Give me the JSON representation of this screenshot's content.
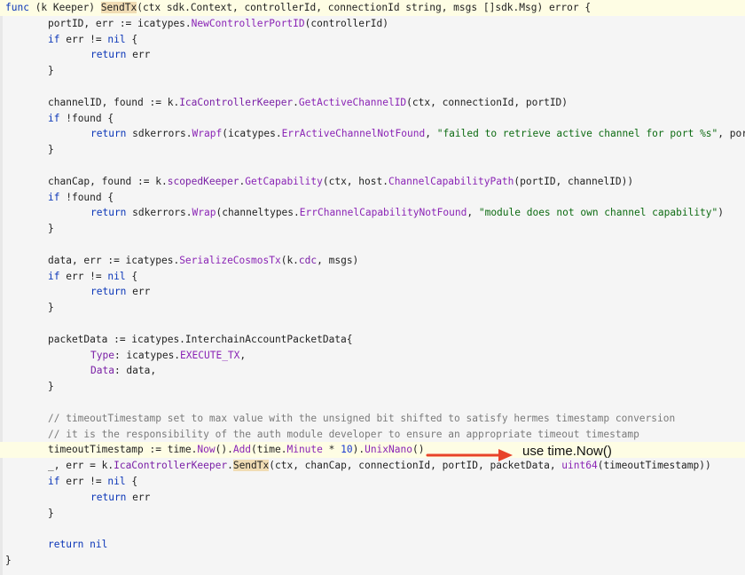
{
  "code_lines": [
    {
      "top": 0,
      "highlight": true,
      "tokens": [
        {
          "t": "func",
          "c": "kw"
        },
        {
          "t": " (k Keeper) ",
          "c": ""
        },
        {
          "t": "SendTx",
          "c": "sendtx"
        },
        {
          "t": "(ctx sdk.Context, controllerId, connectionId string, msgs []sdk.Msg) error {",
          "c": ""
        }
      ]
    },
    {
      "indent": 1,
      "tokens": [
        {
          "t": "portID, err := icatypes.",
          "c": ""
        },
        {
          "t": "NewControllerPortID",
          "c": "fn"
        },
        {
          "t": "(controllerId)",
          "c": ""
        }
      ]
    },
    {
      "indent": 1,
      "tokens": [
        {
          "t": "if",
          "c": "kw"
        },
        {
          "t": " err != ",
          "c": ""
        },
        {
          "t": "nil",
          "c": "kw"
        },
        {
          "t": " {",
          "c": ""
        }
      ]
    },
    {
      "indent": 2,
      "tokens": [
        {
          "t": "return",
          "c": "kw"
        },
        {
          "t": " err",
          "c": ""
        }
      ]
    },
    {
      "indent": 1,
      "tokens": [
        {
          "t": "}",
          "c": ""
        }
      ]
    },
    {
      "indent": 0,
      "tokens": []
    },
    {
      "indent": 1,
      "tokens": [
        {
          "t": "channelID, found := k.",
          "c": ""
        },
        {
          "t": "IcaControllerKeeper",
          "c": "fld"
        },
        {
          "t": ".",
          "c": ""
        },
        {
          "t": "GetActiveChannelID",
          "c": "fn"
        },
        {
          "t": "(ctx, connectionId, portID)",
          "c": ""
        }
      ]
    },
    {
      "indent": 1,
      "tokens": [
        {
          "t": "if",
          "c": "kw"
        },
        {
          "t": " !found {",
          "c": ""
        }
      ]
    },
    {
      "indent": 2,
      "tokens": [
        {
          "t": "return",
          "c": "kw"
        },
        {
          "t": " sdkerrors.",
          "c": ""
        },
        {
          "t": "Wrapf",
          "c": "fn"
        },
        {
          "t": "(icatypes.",
          "c": ""
        },
        {
          "t": "ErrActiveChannelNotFound",
          "c": "fn"
        },
        {
          "t": ", ",
          "c": ""
        },
        {
          "t": "\"failed to retrieve active channel for port %s\"",
          "c": "str"
        },
        {
          "t": ", portID)",
          "c": ""
        }
      ]
    },
    {
      "indent": 1,
      "tokens": [
        {
          "t": "}",
          "c": ""
        }
      ]
    },
    {
      "indent": 0,
      "tokens": []
    },
    {
      "indent": 1,
      "tokens": [
        {
          "t": "chanCap, found := k.",
          "c": ""
        },
        {
          "t": "scopedKeeper",
          "c": "fld"
        },
        {
          "t": ".",
          "c": ""
        },
        {
          "t": "GetCapability",
          "c": "fn"
        },
        {
          "t": "(ctx, host.",
          "c": ""
        },
        {
          "t": "ChannelCapabilityPath",
          "c": "fn"
        },
        {
          "t": "(portID, channelID))",
          "c": ""
        }
      ]
    },
    {
      "indent": 1,
      "tokens": [
        {
          "t": "if",
          "c": "kw"
        },
        {
          "t": " !found {",
          "c": ""
        }
      ]
    },
    {
      "indent": 2,
      "tokens": [
        {
          "t": "return",
          "c": "kw"
        },
        {
          "t": " sdkerrors.",
          "c": ""
        },
        {
          "t": "Wrap",
          "c": "fn"
        },
        {
          "t": "(channeltypes.",
          "c": ""
        },
        {
          "t": "ErrChannelCapabilityNotFound",
          "c": "fn"
        },
        {
          "t": ", ",
          "c": ""
        },
        {
          "t": "\"module does not own channel capability\"",
          "c": "str"
        },
        {
          "t": ")",
          "c": ""
        }
      ]
    },
    {
      "indent": 1,
      "tokens": [
        {
          "t": "}",
          "c": ""
        }
      ]
    },
    {
      "indent": 0,
      "tokens": []
    },
    {
      "indent": 1,
      "tokens": [
        {
          "t": "data, err := icatypes.",
          "c": ""
        },
        {
          "t": "SerializeCosmosTx",
          "c": "fn"
        },
        {
          "t": "(k.",
          "c": ""
        },
        {
          "t": "cdc",
          "c": "fld"
        },
        {
          "t": ", msgs)",
          "c": ""
        }
      ]
    },
    {
      "indent": 1,
      "tokens": [
        {
          "t": "if",
          "c": "kw"
        },
        {
          "t": " err != ",
          "c": ""
        },
        {
          "t": "nil",
          "c": "kw"
        },
        {
          "t": " {",
          "c": ""
        }
      ]
    },
    {
      "indent": 2,
      "tokens": [
        {
          "t": "return",
          "c": "kw"
        },
        {
          "t": " err",
          "c": ""
        }
      ]
    },
    {
      "indent": 1,
      "tokens": [
        {
          "t": "}",
          "c": ""
        }
      ]
    },
    {
      "indent": 0,
      "tokens": []
    },
    {
      "indent": 1,
      "tokens": [
        {
          "t": "packetData := icatypes.InterchainAccountPacketData{",
          "c": ""
        }
      ]
    },
    {
      "indent": 2,
      "tokens": [
        {
          "t": "Type",
          "c": "fld"
        },
        {
          "t": ": icatypes.",
          "c": ""
        },
        {
          "t": "EXECUTE_TX",
          "c": "fn"
        },
        {
          "t": ",",
          "c": ""
        }
      ]
    },
    {
      "indent": 2,
      "tokens": [
        {
          "t": "Data",
          "c": "fld"
        },
        {
          "t": ": data,",
          "c": ""
        }
      ]
    },
    {
      "indent": 1,
      "tokens": [
        {
          "t": "}",
          "c": ""
        }
      ]
    },
    {
      "indent": 0,
      "tokens": []
    },
    {
      "indent": 1,
      "tokens": [
        {
          "t": "// timeoutTimestamp set to max value with the unsigned bit shifted to satisfy hermes timestamp conversion",
          "c": "cmt"
        }
      ]
    },
    {
      "indent": 1,
      "tokens": [
        {
          "t": "// it is the responsibility of the auth module developer to ensure an appropriate timeout timestamp",
          "c": "cmt"
        }
      ]
    },
    {
      "indent": 1,
      "highlight": true,
      "tokens": [
        {
          "t": "timeoutTimestamp := time.",
          "c": ""
        },
        {
          "t": "Now",
          "c": "fn"
        },
        {
          "t": "().",
          "c": ""
        },
        {
          "t": "Add",
          "c": "fn"
        },
        {
          "t": "(time.",
          "c": ""
        },
        {
          "t": "Minute",
          "c": "fn"
        },
        {
          "t": " * ",
          "c": ""
        },
        {
          "t": "10",
          "c": "num"
        },
        {
          "t": ").",
          "c": ""
        },
        {
          "t": "UnixNano",
          "c": "fn"
        },
        {
          "t": "()",
          "c": ""
        }
      ]
    },
    {
      "indent": 1,
      "tokens": [
        {
          "t": "_, err = k.",
          "c": ""
        },
        {
          "t": "IcaControllerKeeper",
          "c": "fld"
        },
        {
          "t": ".",
          "c": ""
        },
        {
          "t": "SendTx",
          "c": "sendtx"
        },
        {
          "t": "(ctx, chanCap, connectionId, portID, packetData, ",
          "c": ""
        },
        {
          "t": "uint64",
          "c": "fn"
        },
        {
          "t": "(timeoutTimestamp))",
          "c": ""
        }
      ]
    },
    {
      "indent": 1,
      "tokens": [
        {
          "t": "if",
          "c": "kw"
        },
        {
          "t": " err != ",
          "c": ""
        },
        {
          "t": "nil",
          "c": "kw"
        },
        {
          "t": " {",
          "c": ""
        }
      ]
    },
    {
      "indent": 2,
      "tokens": [
        {
          "t": "return",
          "c": "kw"
        },
        {
          "t": " err",
          "c": ""
        }
      ]
    },
    {
      "indent": 1,
      "tokens": [
        {
          "t": "}",
          "c": ""
        }
      ]
    },
    {
      "indent": 0,
      "tokens": []
    },
    {
      "indent": 1,
      "tokens": [
        {
          "t": "return",
          "c": "kw"
        },
        {
          "t": " ",
          "c": ""
        },
        {
          "t": "nil",
          "c": "kw"
        }
      ]
    },
    {
      "indent": 0,
      "tokens": [
        {
          "t": "}",
          "c": ""
        }
      ]
    }
  ],
  "annotation": {
    "text": "use time.Now()",
    "arrow_color": "#e8432a"
  }
}
